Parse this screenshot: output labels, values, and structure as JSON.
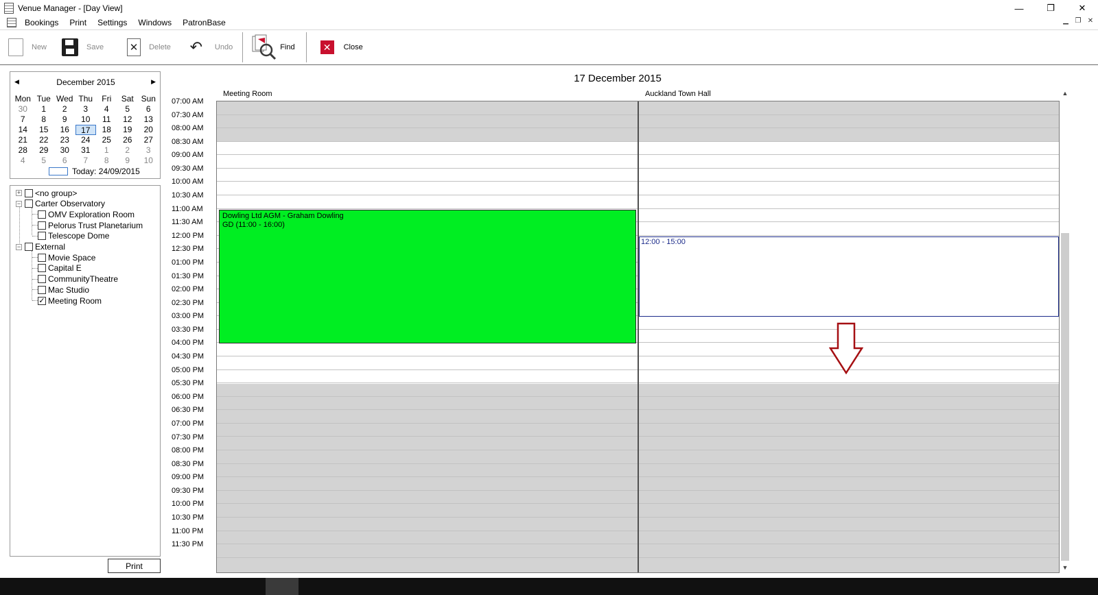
{
  "window": {
    "title": "Venue Manager - [Day View]",
    "controls": {
      "minimize": "—",
      "restore": "❐",
      "close": "✕"
    }
  },
  "menu": {
    "items": [
      "Bookings",
      "Print",
      "Settings",
      "Windows",
      "PatronBase"
    ]
  },
  "toolbar": {
    "new_label": "New",
    "save_label": "Save",
    "delete_label": "Delete",
    "undo_label": "Undo",
    "find_label": "Find",
    "close_label": "Close"
  },
  "calendar": {
    "month_label": "December 2015",
    "weekdays": [
      "Mon",
      "Tue",
      "Wed",
      "Thu",
      "Fri",
      "Sat",
      "Sun"
    ],
    "weeks": [
      [
        "30",
        "1",
        "2",
        "3",
        "4",
        "5",
        "6"
      ],
      [
        "7",
        "8",
        "9",
        "10",
        "11",
        "12",
        "13"
      ],
      [
        "14",
        "15",
        "16",
        "17",
        "18",
        "19",
        "20"
      ],
      [
        "21",
        "22",
        "23",
        "24",
        "25",
        "26",
        "27"
      ],
      [
        "28",
        "29",
        "30",
        "31",
        "1",
        "2",
        "3"
      ],
      [
        "4",
        "5",
        "6",
        "7",
        "8",
        "9",
        "10"
      ]
    ],
    "selected_day": "17",
    "today_text": "Today: 24/09/2015"
  },
  "tree": {
    "nodes": [
      {
        "label": "<no group>",
        "level": 0,
        "expander": "+",
        "checked": false
      },
      {
        "label": "Carter Observatory",
        "level": 0,
        "expander": "−",
        "checked": false
      },
      {
        "label": "OMV Exploration Room",
        "level": 1,
        "checked": false
      },
      {
        "label": "Pelorus Trust Planetarium",
        "level": 1,
        "checked": false
      },
      {
        "label": "Telescope Dome",
        "level": 1,
        "checked": false
      },
      {
        "label": "External",
        "level": 0,
        "expander": "−",
        "checked": false
      },
      {
        "label": "Movie Space",
        "level": 1,
        "checked": false
      },
      {
        "label": "Capital E",
        "level": 1,
        "checked": false
      },
      {
        "label": "CommunityTheatre",
        "level": 1,
        "checked": false
      },
      {
        "label": "Mac Studio",
        "level": 1,
        "checked": false
      },
      {
        "label": "Meeting Room",
        "level": 1,
        "checked": true
      }
    ]
  },
  "print_button": "Print",
  "schedule": {
    "date_title": "17 December 2015",
    "columns": [
      "Meeting Room",
      "Auckland Town Hall"
    ],
    "times": [
      "07:00 AM",
      "07:30 AM",
      "08:00 AM",
      "08:30 AM",
      "09:00 AM",
      "09:30 AM",
      "10:00 AM",
      "10:30 AM",
      "11:00 AM",
      "11:30 AM",
      "12:00 PM",
      "12:30 PM",
      "01:00 PM",
      "01:30 PM",
      "02:00 PM",
      "02:30 PM",
      "03:00 PM",
      "03:30 PM",
      "04:00 PM",
      "04:30 PM",
      "05:00 PM",
      "05:30 PM",
      "06:00 PM",
      "06:30 PM",
      "07:00 PM",
      "07:30 PM",
      "08:00 PM",
      "08:30 PM",
      "09:00 PM",
      "09:30 PM",
      "10:00 PM",
      "10:30 PM",
      "11:00 PM",
      "11:30 PM"
    ],
    "booking": {
      "title": "Dowling Ltd AGM - Graham Dowling",
      "detail": "GD (11:00 - 16:00)",
      "color": "#00ee22"
    },
    "selection_label": "12:00 - 15:00",
    "arrow_color": "#a50f12"
  }
}
